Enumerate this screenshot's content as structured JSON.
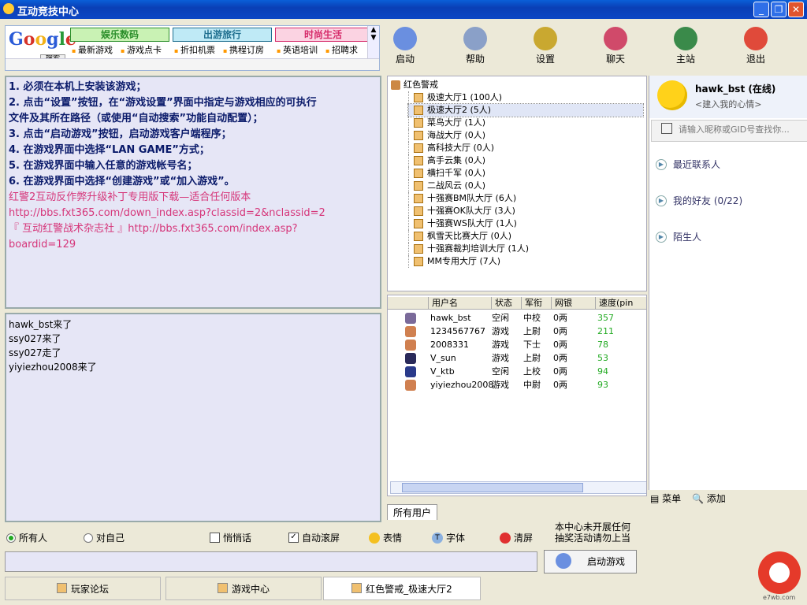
{
  "window": {
    "title": "互动竞技中心"
  },
  "ad": {
    "google": "Google",
    "search_btn": "搜索",
    "categories": [
      {
        "label": "娱乐数码",
        "color": "#2b8f2b",
        "bg": "#c9f2b4"
      },
      {
        "label": "出游旅行",
        "color": "#1f6f8f",
        "bg": "#bfeaf6"
      },
      {
        "label": "时尚生活",
        "color": "#d62b6a",
        "bg": "#fbd3e2"
      }
    ],
    "links": [
      "最新游戏",
      "游戏点卡",
      "折扣机票",
      "携程订房",
      "英语培训",
      "招聘求"
    ]
  },
  "toolbar": {
    "items": [
      {
        "label": "启动",
        "icon": "launch-icon",
        "color": "#6a8fe0"
      },
      {
        "label": "帮助",
        "icon": "help-icon",
        "color": "#8aa0c8"
      },
      {
        "label": "设置",
        "icon": "settings-icon",
        "color": "#c9a830"
      },
      {
        "label": "聊天",
        "icon": "chat-icon",
        "color": "#d04a6a"
      },
      {
        "label": "主站",
        "icon": "home-icon",
        "color": "#3a8a4a"
      },
      {
        "label": "退出",
        "icon": "exit-icon",
        "color": "#e04a3a"
      }
    ]
  },
  "info": {
    "lines": [
      "1. 必须在本机上安装该游戏；",
      "2. 点击“设置”按钮，在“游戏设置”界面中指定与游戏相应的可执行",
      "文件及其所在路径（或使用“自动搜索”功能自动配置）；",
      "3. 点击“启动游戏”按钮，启动游戏客户端程序；",
      "4. 在游戏界面中选择“LAN GAME”方式；",
      "5. 在游戏界面中输入任意的游戏帐号名；",
      "6. 在游戏界面中选择“创建游戏”或“加入游戏”。"
    ],
    "pink_lines": [
      "红警2互动反作弊升级补丁专用版下载—适合任何版本",
      "http://bbs.fxt365.com/down_index.asp?classid=2&nclassid=2",
      "『 互动红警战术杂志社 』http://bbs.fxt365.com/index.asp?",
      "boardid=129"
    ]
  },
  "chat": {
    "messages": [
      "hawk_bst来了",
      "ssy027来了",
      "ssy027走了",
      "yiyiezhou2008来了"
    ]
  },
  "tree": {
    "root": "红色警戒",
    "nodes": [
      "极速大厅1 (100人)",
      "极速大厅2 (5人)",
      "菜鸟大厅 (1人)",
      "海战大厅 (0人)",
      "高科技大厅 (0人)",
      "高手云集 (0人)",
      "横扫千军 (0人)",
      "二战风云 (0人)",
      "十强赛BM队大厅 (6人)",
      "十强赛OK队大厅 (3人)",
      "十强赛WS队大厅 (1人)",
      "枫雪天比赛大厅 (0人)",
      "十强赛裁判培训大厅 (1人)",
      "MM专用大厅 (7人)"
    ],
    "selected_index": 1
  },
  "users": {
    "headers": [
      "用户名",
      "状态",
      "军衔",
      "网银",
      "速度(pin"
    ],
    "rows": [
      {
        "name": "hawk_bst",
        "status": "空闲",
        "rank": "中校",
        "money": "0两",
        "speed": "357",
        "speed_color": "#22aa22",
        "avatar": "#7a6a9a"
      },
      {
        "name": "1234567767",
        "status": "游戏",
        "rank": "上尉",
        "money": "0两",
        "speed": "211",
        "speed_color": "#22aa22",
        "avatar": "#d08050"
      },
      {
        "name": "2008331",
        "status": "游戏",
        "rank": "下士",
        "money": "0两",
        "speed": "78",
        "speed_color": "#22aa22",
        "avatar": "#d08050"
      },
      {
        "name": "V_sun",
        "status": "游戏",
        "rank": "上尉",
        "money": "0两",
        "speed": "53",
        "speed_color": "#22aa22",
        "avatar": "#2a2a5a"
      },
      {
        "name": "V_ktb",
        "status": "空闲",
        "rank": "上校",
        "money": "0两",
        "speed": "94",
        "speed_color": "#22aa22",
        "avatar": "#2a3a8a"
      },
      {
        "name": "yiyiezhou2008",
        "status": "游戏",
        "rank": "中尉",
        "money": "0两",
        "speed": "93",
        "speed_color": "#22aa22",
        "avatar": "#d08050"
      }
    ],
    "tab": "所有用户"
  },
  "contact": {
    "name": "hawk_bst (在线)",
    "mood": "<建入我的心情>",
    "search_placeholder": "请输入昵称或GID号查找你...",
    "groups": [
      "最近联系人",
      "我的好友 (0/22)",
      "陌生人"
    ],
    "menu_label": "菜单",
    "add_label": "添加"
  },
  "controls": {
    "everyone": "所有人",
    "self": "对自己",
    "whisper": "悄悄话",
    "autoscroll": "自动滚屏",
    "emoji": "表情",
    "font": "字体",
    "clear": "清屏",
    "notice_1": "本中心未开展任何",
    "notice_2": "抽奖活动请勿上当",
    "start_game": "启动游戏"
  },
  "bottom_tabs": [
    "玩家论坛",
    "游戏中心",
    "红色警戒_极速大厅2"
  ],
  "logo_text": "e7wb.com"
}
